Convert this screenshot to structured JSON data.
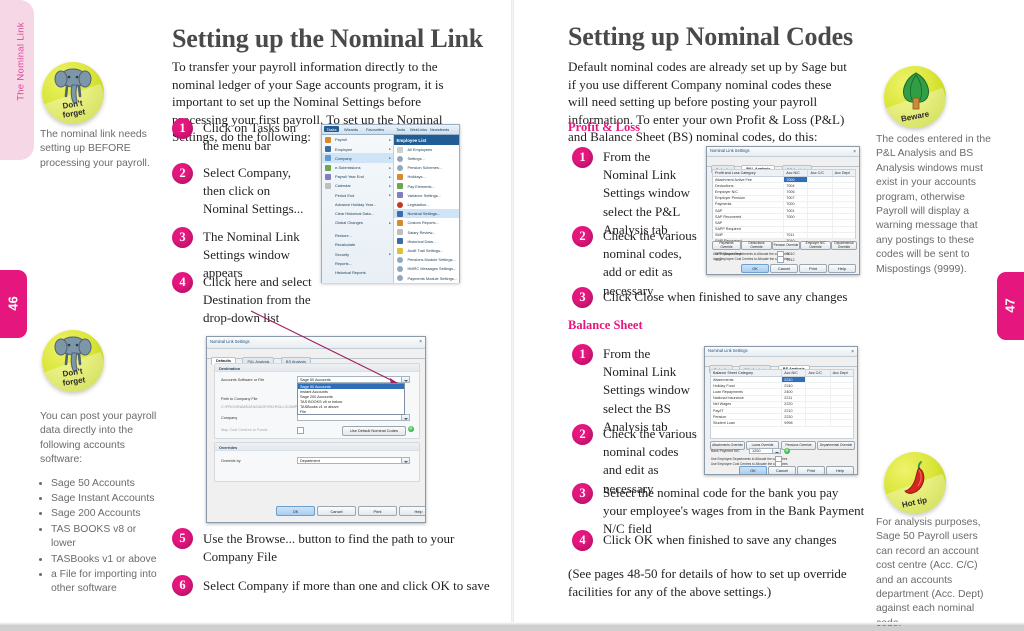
{
  "colors": {
    "accent": "#e5177f",
    "tab_pink": "#f6d7e6",
    "badge_green": "#c3d519",
    "note_grey": "#6b6b6b",
    "heading_grey": "#4a4a4a"
  },
  "chapter_tab": {
    "label": "The Nominal Link"
  },
  "left_page": {
    "number": "46",
    "heading": "Setting up the Nominal Link",
    "intro": "To transfer your payroll information directly to the nominal ledger of your Sage accounts program, it is important to set up the Nominal Settings before processing your first payroll. To set up the Nominal Settings, do the following:",
    "steps": [
      {
        "n": "1",
        "text": "Click on Tasks on the menu bar"
      },
      {
        "n": "2",
        "text": "Select Company, then click on Nominal Settings..."
      },
      {
        "n": "3",
        "text": "The Nominal Link Settings window appears"
      },
      {
        "n": "4",
        "text": "Click here and select Destination from the drop-down list"
      },
      {
        "n": "5",
        "text": "Use the Browse... button to find the path to your Company File"
      },
      {
        "n": "6",
        "text": "Select Company if more than one and click OK to save"
      }
    ],
    "note_top": {
      "badge": "dont-forget",
      "badge_line1": "Don't",
      "badge_line2": "forget",
      "text": "The nominal link needs setting up BEFORE processing your payroll."
    },
    "note_bottom": {
      "badge": "dont-forget",
      "badge_line1": "Don't",
      "badge_line2": "forget",
      "text": "You can post your payroll data directly into the following accounts software:",
      "list": [
        "Sage 50 Accounts",
        "Sage Instant Accounts",
        "Sage 200 Accounts",
        "TAS BOOKS v8 or lower",
        "TASBooks v1 or above",
        "a File for importing into other software"
      ]
    }
  },
  "right_page": {
    "number": "47",
    "heading": "Setting up Nominal Codes",
    "intro": "Default nominal codes are already set up by Sage but if you use different Company nominal codes these will need setting up before posting your payroll information. To enter your own Profit & Loss (P&L) and Balance Sheet (BS) nominal codes, do this:",
    "pl_subhead": "Profit & Loss",
    "pl_steps": [
      {
        "n": "1",
        "text": "From the Nominal Link Settings window select the P&L Analysis tab"
      },
      {
        "n": "2",
        "text": "Check the various nominal codes, add or edit as necessary"
      },
      {
        "n": "3",
        "text": "Click Close when finished to save any changes"
      }
    ],
    "bs_subhead": "Balance Sheet",
    "bs_steps": [
      {
        "n": "1",
        "text": "From the Nominal Link Settings window select the BS Analysis tab"
      },
      {
        "n": "2",
        "text": "Check the various nominal codes and edit as necessary"
      },
      {
        "n": "3",
        "text": "Select the nominal code for the bank you pay your employee's wages from in the Bank Payment N/C field"
      },
      {
        "n": "4",
        "text": "Click OK when finished to save any changes"
      }
    ],
    "footer_note": "(See pages 48-50 for details of how to set up override facilities for any of the above settings.)",
    "note_beware": {
      "badge": "beware",
      "badge_label": "Beware",
      "text": "The codes entered in the P&L Analysis and BS Analysis windows must exist in your accounts program, otherwise Payroll will display a warning message that any postings to these codes will be sent to Mispostings (9999)."
    },
    "note_hottip": {
      "badge": "hot-tip",
      "badge_label": "Hot tip",
      "text": "For analysis purposes, Sage 50 Payroll users can record an account cost centre (Acc. C/C) and an accounts department (Acc. Dept) against each nominal code."
    }
  },
  "sage_menu": {
    "menubar": [
      "Tasks",
      "Wizards",
      "Favourites",
      "Tools",
      "WebLinks",
      "Newsfeeds"
    ],
    "menubar_active": "Tasks",
    "submenu_title": "Employee List",
    "tasks": [
      {
        "label": "Payroll",
        "arrow": true,
        "color": "#d98a2b"
      },
      {
        "label": "Employee",
        "arrow": true,
        "color": "#3a6ea5"
      },
      {
        "label": "Company",
        "arrow": true,
        "color": "#5e9bd1",
        "highlight": true
      },
      {
        "label": "e-Submissions",
        "arrow": true,
        "color": "#6aa84f"
      },
      {
        "label": "Payroll Year End",
        "arrow": true,
        "color": "#7f7fbf"
      },
      {
        "label": "Calendar",
        "arrow": true,
        "color": "#bfbfbf"
      },
      {
        "label": "Period End",
        "arrow": true,
        "color": "#ffffff"
      },
      {
        "label": "Advance Holiday Year...",
        "arrow": false,
        "color": "#ffffff"
      },
      {
        "label": "Clear Historical Data...",
        "arrow": false,
        "color": "#ffffff"
      },
      {
        "label": "Global Changes",
        "arrow": true,
        "color": "#ffffff"
      },
      {
        "label": "Restore...",
        "arrow": false,
        "color": "#ffffff"
      },
      {
        "label": "Recalculate",
        "arrow": false,
        "color": "#ffffff"
      },
      {
        "label": "Security",
        "arrow": true,
        "color": "#ffffff"
      },
      {
        "label": "Reports...",
        "arrow": false,
        "color": "#ffffff"
      },
      {
        "label": "Historical Reports",
        "arrow": false,
        "color": "#ffffff"
      }
    ],
    "company_submenu": [
      {
        "label": "All Employees",
        "color": "#cfcfcf"
      },
      {
        "label": "Settings...",
        "color": "#8fa8bf"
      },
      {
        "label": "Pension Schemes...",
        "color": "#8fa8bf"
      },
      {
        "label": "Holidays...",
        "color": "#d98a2b"
      },
      {
        "label": "Pay Elements...",
        "color": "#6aa84f"
      },
      {
        "label": "Variance Settings...",
        "color": "#7f7fbf"
      },
      {
        "label": "Legislation...",
        "color": "#c0392b"
      },
      {
        "label": "Nominal Settings...",
        "color": "#3a6ea5",
        "highlight": true
      },
      {
        "label": "Custom Reports...",
        "color": "#d98a2b"
      },
      {
        "label": "Salary Review...",
        "color": "#bfbfbf"
      },
      {
        "label": "Historical Data...",
        "color": "#3a6ea5"
      },
      {
        "label": "Audit Trail Settings...",
        "color": "#e0c03a"
      },
      {
        "label": "Pensions Module Settings...",
        "color": "#8fa8bf"
      },
      {
        "label": "HMRC Messages Settings...",
        "color": "#8fa8bf"
      },
      {
        "label": "Payments Module Settings...",
        "color": "#8fa8bf"
      }
    ]
  },
  "dialog_defaults": {
    "title": "Nominal Link Settings",
    "close": "×",
    "tabs": [
      "Defaults",
      "P&L Analysis",
      "BS Analysis"
    ],
    "active_tab": "Defaults",
    "group_destination": "Destination",
    "label_software": "Accounts Software or File",
    "value_software": "Sage 50 Accounts",
    "label_path": "Path to Company File",
    "value_path": "C:\\PROGRAMDATA\\SAGE\\PAYROLL\\COMPANY",
    "label_company": "Company",
    "value_company": "",
    "label_map_cost": "Map Cost Centres to Funds",
    "button_defaults": "Use Default Nominal Codes",
    "dropdown_options": [
      "Sage 50 Accounts",
      "Instant Accounts",
      "Sage 200 Accounts",
      "TAS BOOKS v8 or below",
      "TASBooks v1 or above",
      "File"
    ],
    "dropdown_selected": "Sage 50 Accounts",
    "group_overrides": "Overrides",
    "label_override_by": "Override by",
    "value_override_by": "Department",
    "buttons": [
      "OK",
      "Cancel",
      "Print",
      "Help"
    ]
  },
  "dialog_pl": {
    "title": "Nominal Link Settings",
    "close": "×",
    "tabs": [
      "Defaults",
      "P&L Analysis",
      "BS Analysis"
    ],
    "active_tab": "P&L Analysis",
    "columns": [
      "Profit and Loss Category",
      "Acc N/C",
      "Acc C/C",
      "Acc Dept"
    ],
    "rows": [
      {
        "cat": "Attachment Active Fee",
        "nc": "7000",
        "selected": true
      },
      {
        "cat": "Deductions",
        "nc": "7004"
      },
      {
        "cat": "Employer N/C",
        "nc": "7006"
      },
      {
        "cat": "Employer Pension",
        "nc": "7007"
      },
      {
        "cat": "Payments",
        "nc": "7000"
      },
      {
        "cat": "SAP",
        "nc": "7001"
      },
      {
        "cat": "SAP Recovered",
        "nc": "7000"
      },
      {
        "cat": "SAP",
        "nc": ""
      },
      {
        "cat": "SAPP Required",
        "nc": ""
      },
      {
        "cat": "SMP",
        "nc": "7011"
      },
      {
        "cat": "SMP Recovered",
        "nc": "7010"
      },
      {
        "cat": "SPP",
        "nc": "7011"
      },
      {
        "cat": "SPP Recovered",
        "nc": "7010"
      },
      {
        "cat": "SSP",
        "nc": "7012"
      }
    ],
    "override_buttons": [
      "Payments Override",
      "Deductions Override",
      "Pension Override",
      "Employer N/C Override",
      "Departmental Override"
    ],
    "check1": "Use Employee Departments to Allocate the categories",
    "check2": "Use Employee Cost Centres to Allocate the categories",
    "buttons": [
      "OK",
      "Cancel",
      "Print",
      "Help"
    ]
  },
  "dialog_bs": {
    "title": "Nominal Link Settings",
    "close": "×",
    "tabs": [
      "Defaults",
      "P&L Analysis",
      "BS Analysis"
    ],
    "active_tab": "BS Analysis",
    "columns": [
      "Balance Sheet Category",
      "Acc N/C",
      "Acc C/C",
      "Acc Dept"
    ],
    "rows": [
      {
        "cat": "Attachments",
        "nc": "2210",
        "selected": true
      },
      {
        "cat": "Holiday Fund",
        "nc": "2240"
      },
      {
        "cat": "Loan Repayments",
        "nc": "2400"
      },
      {
        "cat": "National Insurance",
        "nc": "2211"
      },
      {
        "cat": "Net Wages",
        "nc": "2220"
      },
      {
        "cat": "Pay/IT",
        "nc": "2210"
      },
      {
        "cat": "Pension",
        "nc": "2230"
      },
      {
        "cat": "Student Loan",
        "nc": "9998"
      }
    ],
    "override_buttons": [
      "Attachments Override",
      "Loans Override",
      "Pensions Override",
      "Departmental Override"
    ],
    "label_bank": "Bank Payment N/C",
    "value_bank": "1200",
    "check1": "Use Employee Departments to Allocate the categories",
    "check2": "Use Employee Cost Centres to Allocate the categories",
    "buttons": [
      "OK",
      "Cancel",
      "Print",
      "Help"
    ]
  }
}
